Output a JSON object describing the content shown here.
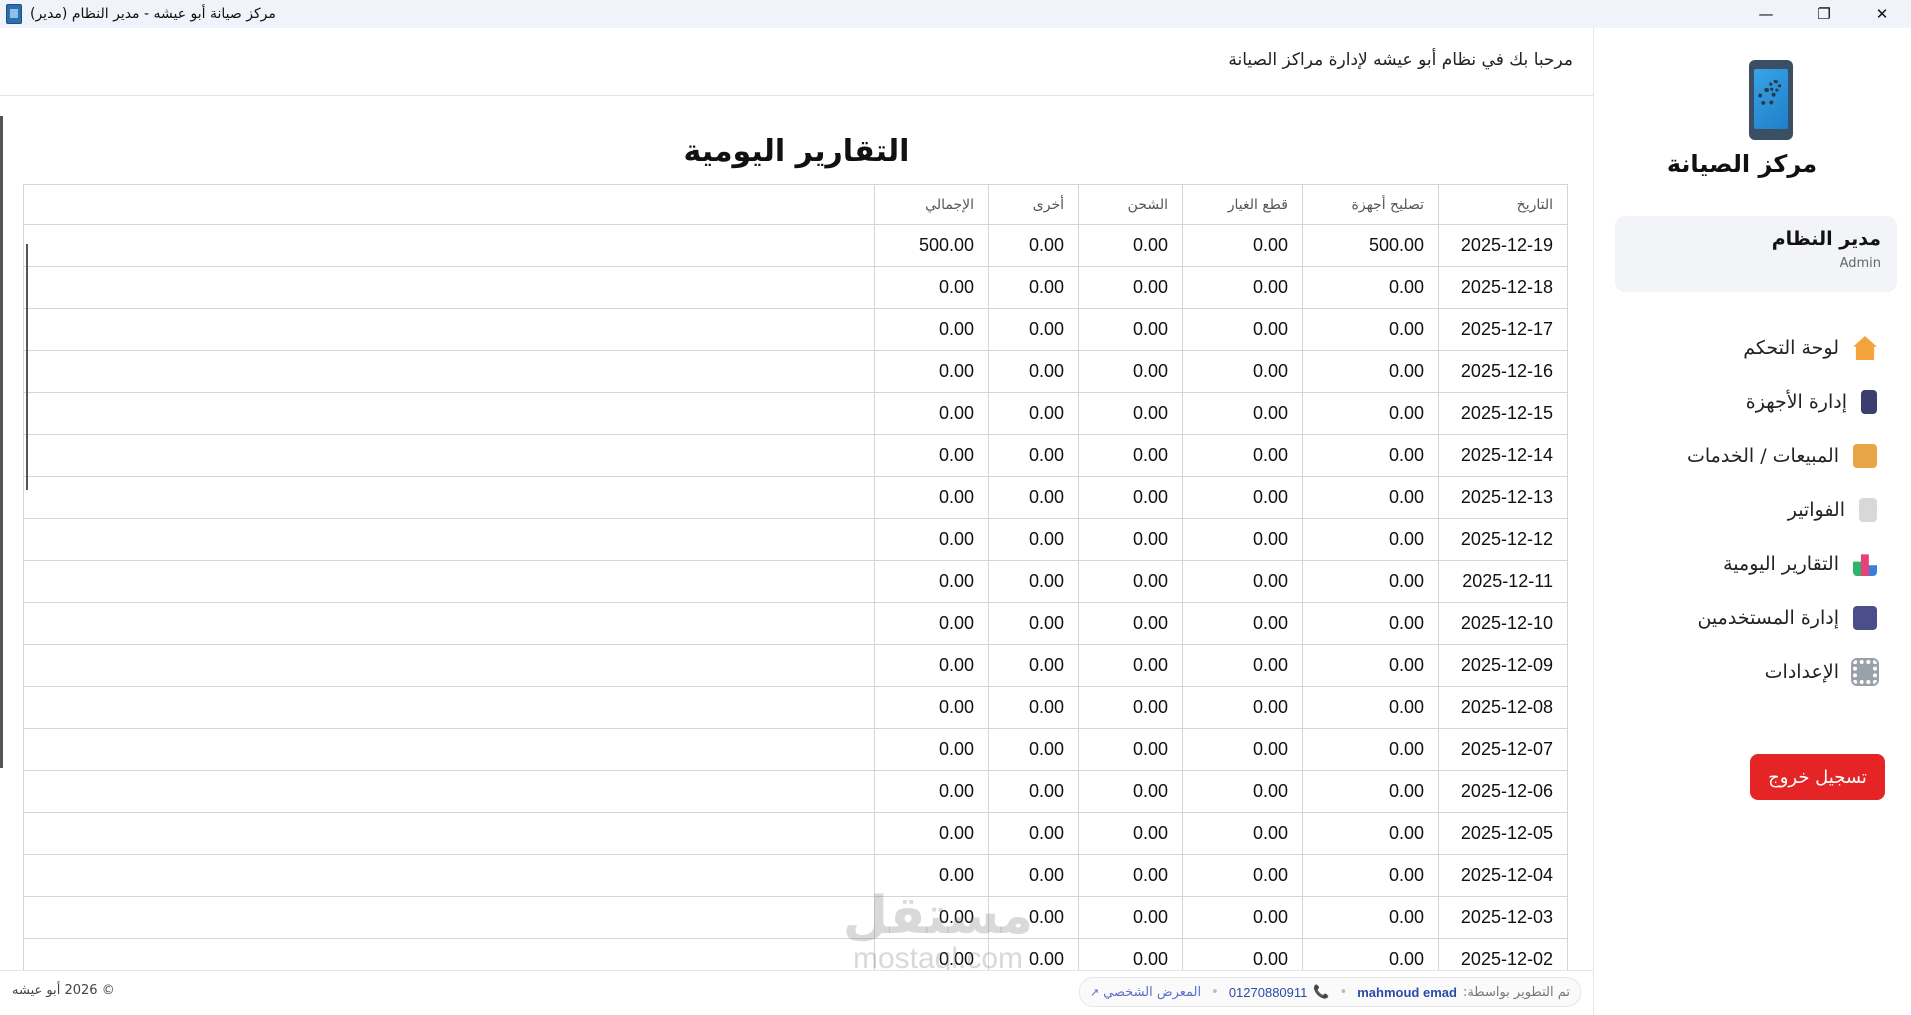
{
  "window": {
    "title": "مركز صيانة أبو عيشه - مدير النظام (مدير)",
    "controls": {
      "minimize": "—",
      "restore": "❐",
      "close": "✕"
    }
  },
  "sidebar": {
    "brand": "مركز الصيانة",
    "user": {
      "name": "مدير النظام",
      "role": "Admin"
    },
    "items": [
      {
        "label": "لوحة التحكم",
        "icon": "home-icon"
      },
      {
        "label": "إدارة الأجهزة",
        "icon": "phone-icon"
      },
      {
        "label": "المبيعات / الخدمات",
        "icon": "money-bag-icon"
      },
      {
        "label": "الفواتير",
        "icon": "invoice-icon"
      },
      {
        "label": "التقارير اليومية",
        "icon": "chart-icon"
      },
      {
        "label": "إدارة المستخدمين",
        "icon": "users-icon"
      },
      {
        "label": "الإعدادات",
        "icon": "gear-icon"
      }
    ],
    "logout": "تسجيل خروج"
  },
  "header": {
    "welcome": "مرحبا بك في نظام أبو عيشه لإدارة مراكز الصيانة"
  },
  "page": {
    "title": "التقارير اليومية"
  },
  "table": {
    "headers": [
      "التاريخ",
      "تصليح أجهزة",
      "قطع الغيار",
      "الشحن",
      "أخرى",
      "الإجمالي"
    ],
    "rows": [
      [
        "2025-12-19",
        "500.00",
        "0.00",
        "0.00",
        "0.00",
        "500.00"
      ],
      [
        "2025-12-18",
        "0.00",
        "0.00",
        "0.00",
        "0.00",
        "0.00"
      ],
      [
        "2025-12-17",
        "0.00",
        "0.00",
        "0.00",
        "0.00",
        "0.00"
      ],
      [
        "2025-12-16",
        "0.00",
        "0.00",
        "0.00",
        "0.00",
        "0.00"
      ],
      [
        "2025-12-15",
        "0.00",
        "0.00",
        "0.00",
        "0.00",
        "0.00"
      ],
      [
        "2025-12-14",
        "0.00",
        "0.00",
        "0.00",
        "0.00",
        "0.00"
      ],
      [
        "2025-12-13",
        "0.00",
        "0.00",
        "0.00",
        "0.00",
        "0.00"
      ],
      [
        "2025-12-12",
        "0.00",
        "0.00",
        "0.00",
        "0.00",
        "0.00"
      ],
      [
        "2025-12-11",
        "0.00",
        "0.00",
        "0.00",
        "0.00",
        "0.00"
      ],
      [
        "2025-12-10",
        "0.00",
        "0.00",
        "0.00",
        "0.00",
        "0.00"
      ],
      [
        "2025-12-09",
        "0.00",
        "0.00",
        "0.00",
        "0.00",
        "0.00"
      ],
      [
        "2025-12-08",
        "0.00",
        "0.00",
        "0.00",
        "0.00",
        "0.00"
      ],
      [
        "2025-12-07",
        "0.00",
        "0.00",
        "0.00",
        "0.00",
        "0.00"
      ],
      [
        "2025-12-06",
        "0.00",
        "0.00",
        "0.00",
        "0.00",
        "0.00"
      ],
      [
        "2025-12-05",
        "0.00",
        "0.00",
        "0.00",
        "0.00",
        "0.00"
      ],
      [
        "2025-12-04",
        "0.00",
        "0.00",
        "0.00",
        "0.00",
        "0.00"
      ],
      [
        "2025-12-03",
        "0.00",
        "0.00",
        "0.00",
        "0.00",
        "0.00"
      ],
      [
        "2025-12-02",
        "0.00",
        "0.00",
        "0.00",
        "0.00",
        "0.00"
      ]
    ]
  },
  "watermark": {
    "arabic": "مستقل",
    "english": "mostaql.com"
  },
  "footer": {
    "copyright": "© 2026 أبو عيشه",
    "developed_by_label": "تم التطوير بواسطة:",
    "developer": "mahmoud emad",
    "phone": "01270880911",
    "portfolio": "المعرض الشخصي"
  }
}
